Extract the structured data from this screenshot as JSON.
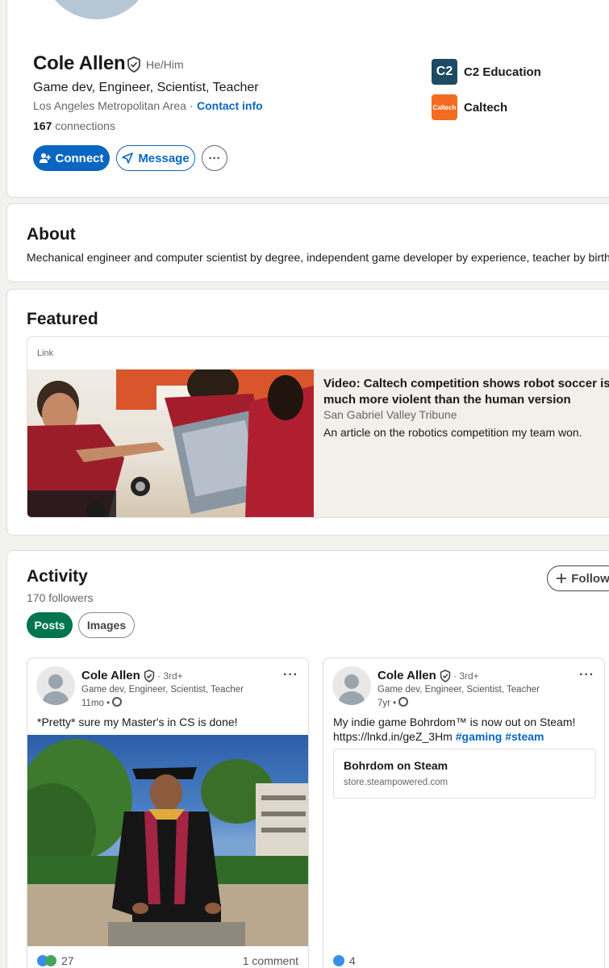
{
  "profile": {
    "name": "Cole Allen",
    "pronouns": "He/Him",
    "headline": "Game dev, Engineer, Scientist,  Teacher",
    "location": "Los Angeles Metropolitan Area",
    "separator": "·",
    "contact_label": "Contact info",
    "connections_count": "167",
    "connections_label": "connections",
    "connect_label": "Connect",
    "message_label": "Message",
    "more_label": "···",
    "orgs": [
      {
        "name": "C2 Education",
        "logo_text": "C2"
      },
      {
        "name": "Caltech",
        "logo_text": "Caltech"
      }
    ]
  },
  "about": {
    "title": "About",
    "text": "Mechanical engineer and computer scientist by degree, independent game developer by experience, teacher by birth."
  },
  "featured": {
    "title": "Featured",
    "type_label": "Link",
    "article_title": "Video: Caltech competition shows robot soccer is much more violent than the human version",
    "source": "San Gabriel Valley Tribune",
    "description": "An article on the robotics competition my team won."
  },
  "activity": {
    "title": "Activity",
    "followers": "170 followers",
    "follow_label": "Follow",
    "tabs": [
      "Posts",
      "Images"
    ],
    "posts": [
      {
        "author": "Cole Allen",
        "degree": "· 3rd+",
        "headline": "Game dev, Engineer, Scientist,  Teacher",
        "time": "11mo •",
        "text": "*Pretty* sure my Master's in CS is done!",
        "reactions": "27",
        "comments": "1 comment"
      },
      {
        "author": "Cole Allen",
        "degree": "· 3rd+",
        "headline": "Game dev, Engineer, Scientist,  Teacher",
        "time": "7yr •",
        "text_line1": "My indie game Bohrdom™ is now out on Steam!",
        "text_link": "https://lnkd.in/geZ_3Hm",
        "hashtag1": "#gaming",
        "hashtag2": "#steam",
        "link_title": "Bohrdom on Steam",
        "link_domain": "store.steampowered.com",
        "reactions": "4"
      }
    ]
  },
  "colors": {
    "primary_blue": "#0a66c2",
    "posts_green": "#01754f",
    "caltech_orange": "#f26b21",
    "c2_navy": "#1e4a63"
  }
}
